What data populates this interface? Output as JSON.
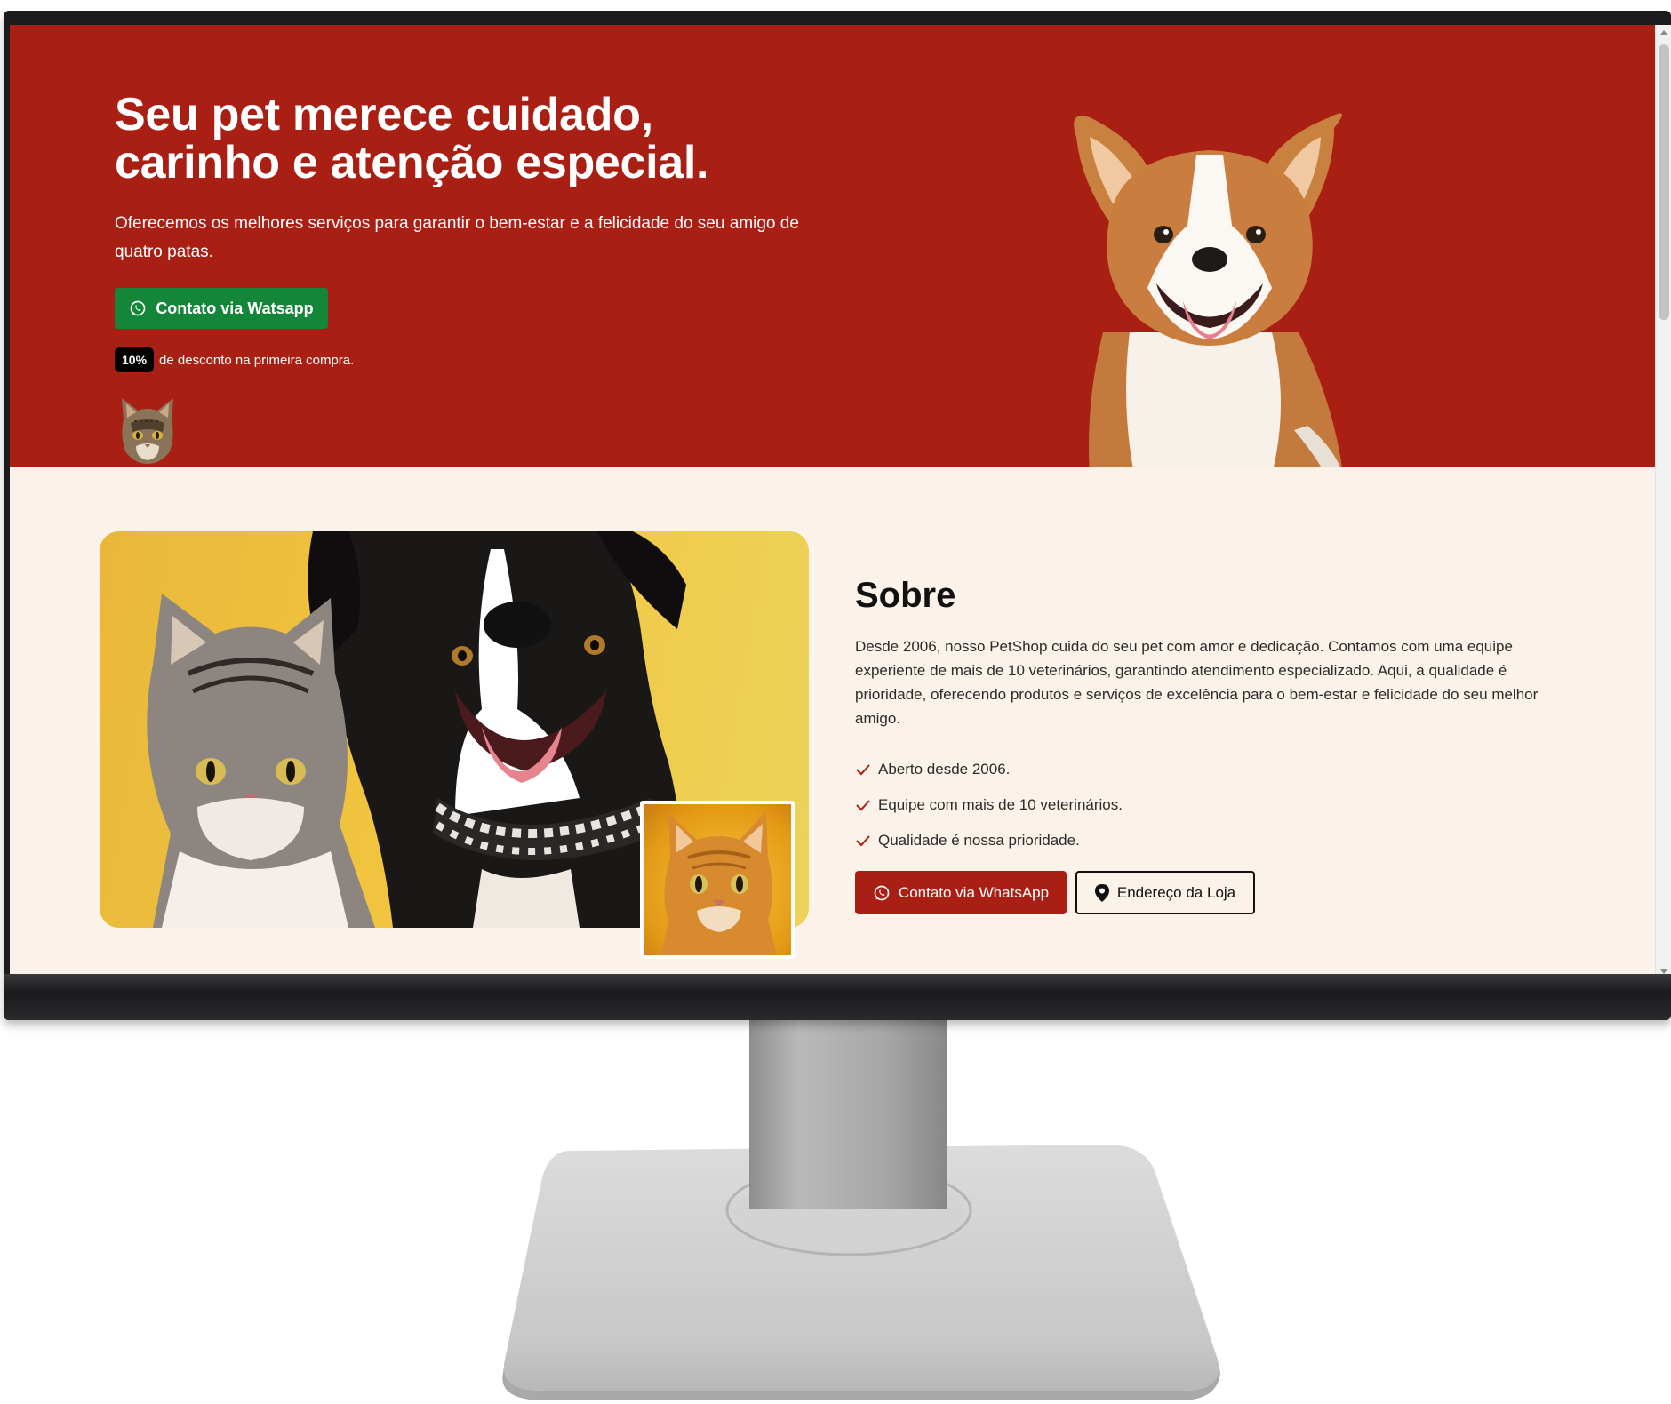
{
  "hero": {
    "title_line1": "Seu pet merece cuidado,",
    "title_line2": "carinho e atenção especial.",
    "subtitle": "Oferecemos os melhores serviços para garantir o bem-estar e a felicidade do seu amigo de quatro patas.",
    "cta_label": "Contato via Watsapp",
    "cta_icon": "whatsapp-icon",
    "promo_badge": "10%",
    "promo_text": "de desconto na primeira compra."
  },
  "about": {
    "title": "Sobre",
    "text": "Desde 2006, nosso PetShop cuida do seu pet com amor e dedicação. Contamos com uma equipe experiente de mais de 10 veterinários, garantindo atendimento especializado. Aqui, a qualidade é prioridade, oferecendo produtos e serviços de excelência para o bem-estar e felicidade do seu melhor amigo.",
    "features": [
      "Aberto desde 2006.",
      "Equipe com mais de 10 veterinários.",
      "Qualidade é nossa prioridade."
    ],
    "whatsapp_label": "Contato via WhatsApp",
    "address_label": "Endereço da Loja",
    "address_icon": "map-pin-icon"
  },
  "colors": {
    "brand_red": "#a91f14",
    "whatsapp_green": "#13863a",
    "page_cream": "#fbf3ea"
  }
}
